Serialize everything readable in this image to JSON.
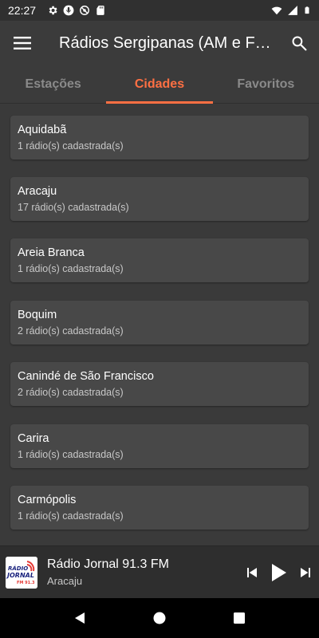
{
  "status_bar": {
    "time": "22:27",
    "left_icons": [
      "gear-icon",
      "mic-icon",
      "sync-off-icon",
      "sd-card-icon"
    ],
    "right_icons": [
      "wifi-icon",
      "signal-icon",
      "battery-icon"
    ]
  },
  "app_bar": {
    "title": "Rádios Sergipanas (AM e F…",
    "menu_icon": "menu-icon",
    "search_icon": "search-icon"
  },
  "tabs": [
    {
      "label": "Estações",
      "active": false
    },
    {
      "label": "Cidades",
      "active": true
    },
    {
      "label": "Favoritos",
      "active": false
    }
  ],
  "accent_color": "#ff7043",
  "cities": [
    {
      "name": "Aquidabã",
      "count": "1 rádio(s) cadastrada(s)"
    },
    {
      "name": "Aracaju",
      "count": "17 rádio(s) cadastrada(s)"
    },
    {
      "name": "Areia Branca",
      "count": "1 rádio(s) cadastrada(s)"
    },
    {
      "name": "Boquim",
      "count": "2 rádio(s) cadastrada(s)"
    },
    {
      "name": "Canindé de São Francisco",
      "count": "2 rádio(s) cadastrada(s)"
    },
    {
      "name": "Carira",
      "count": "1 rádio(s) cadastrada(s)"
    },
    {
      "name": "Carmópolis",
      "count": "1 rádio(s) cadastrada(s)"
    }
  ],
  "player": {
    "title": "Rádio Jornal 91.3 FM",
    "city": "Aracaju",
    "logo_text_top": "RÁDIO",
    "logo_text_main": "JORNAL",
    "logo_text_fm": "FM 91.3"
  },
  "nav_bar": {
    "buttons": [
      "back-icon",
      "home-icon",
      "recents-icon"
    ]
  }
}
